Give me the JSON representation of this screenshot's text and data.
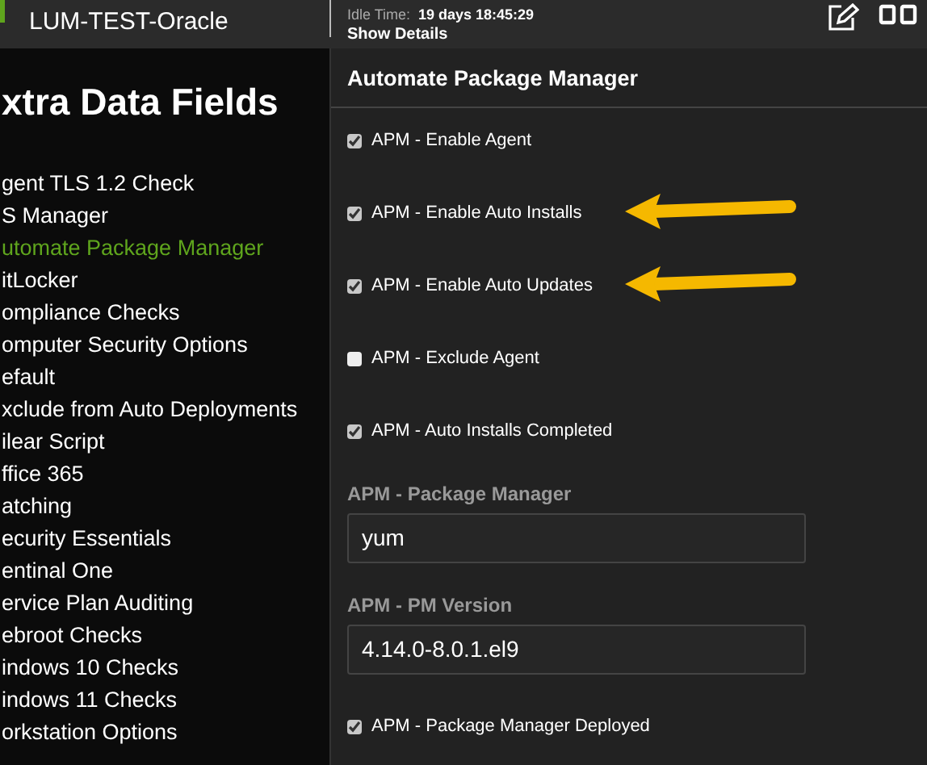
{
  "header": {
    "device_name": "LUM-TEST-Oracle",
    "idle_label": "Idle Time:",
    "idle_value": "19 days 18:45:29",
    "details_link": "Show Details"
  },
  "sidebar": {
    "title": "xtra Data Fields",
    "items": [
      {
        "label": "gent TLS 1.2 Check",
        "selected": false
      },
      {
        "label": "S Manager",
        "selected": false
      },
      {
        "label": "utomate Package Manager",
        "selected": true
      },
      {
        "label": "itLocker",
        "selected": false
      },
      {
        "label": "ompliance Checks",
        "selected": false
      },
      {
        "label": "omputer Security Options",
        "selected": false
      },
      {
        "label": "efault",
        "selected": false
      },
      {
        "label": "xclude from Auto Deployments",
        "selected": false
      },
      {
        "label": "ilear Script",
        "selected": false
      },
      {
        "label": "ffice 365",
        "selected": false
      },
      {
        "label": "atching",
        "selected": false
      },
      {
        "label": "ecurity Essentials",
        "selected": false
      },
      {
        "label": "entinal One",
        "selected": false
      },
      {
        "label": "ervice Plan Auditing",
        "selected": false
      },
      {
        "label": "ebroot Checks",
        "selected": false
      },
      {
        "label": "indows 10 Checks",
        "selected": false
      },
      {
        "label": "indows 11 Checks",
        "selected": false
      },
      {
        "label": "orkstation Options",
        "selected": false
      }
    ]
  },
  "panel": {
    "title": "Automate Package Manager",
    "fields": [
      {
        "kind": "checkbox",
        "label": "APM - Enable Agent",
        "checked": true,
        "arrow": false
      },
      {
        "kind": "checkbox",
        "label": "APM - Enable Auto Installs",
        "checked": true,
        "arrow": true
      },
      {
        "kind": "checkbox",
        "label": "APM - Enable Auto Updates",
        "checked": true,
        "arrow": true
      },
      {
        "kind": "checkbox",
        "label": "APM - Exclude Agent",
        "checked": false,
        "arrow": false
      },
      {
        "kind": "checkbox",
        "label": "APM - Auto Installs Completed",
        "checked": true,
        "arrow": false
      },
      {
        "kind": "text",
        "label": "APM - Package Manager",
        "value": "yum"
      },
      {
        "kind": "text",
        "label": "APM - PM Version",
        "value": "4.14.0-8.0.1.el9"
      },
      {
        "kind": "checkbox",
        "label": "APM - Package Manager Deployed",
        "checked": true,
        "arrow": false
      }
    ]
  }
}
